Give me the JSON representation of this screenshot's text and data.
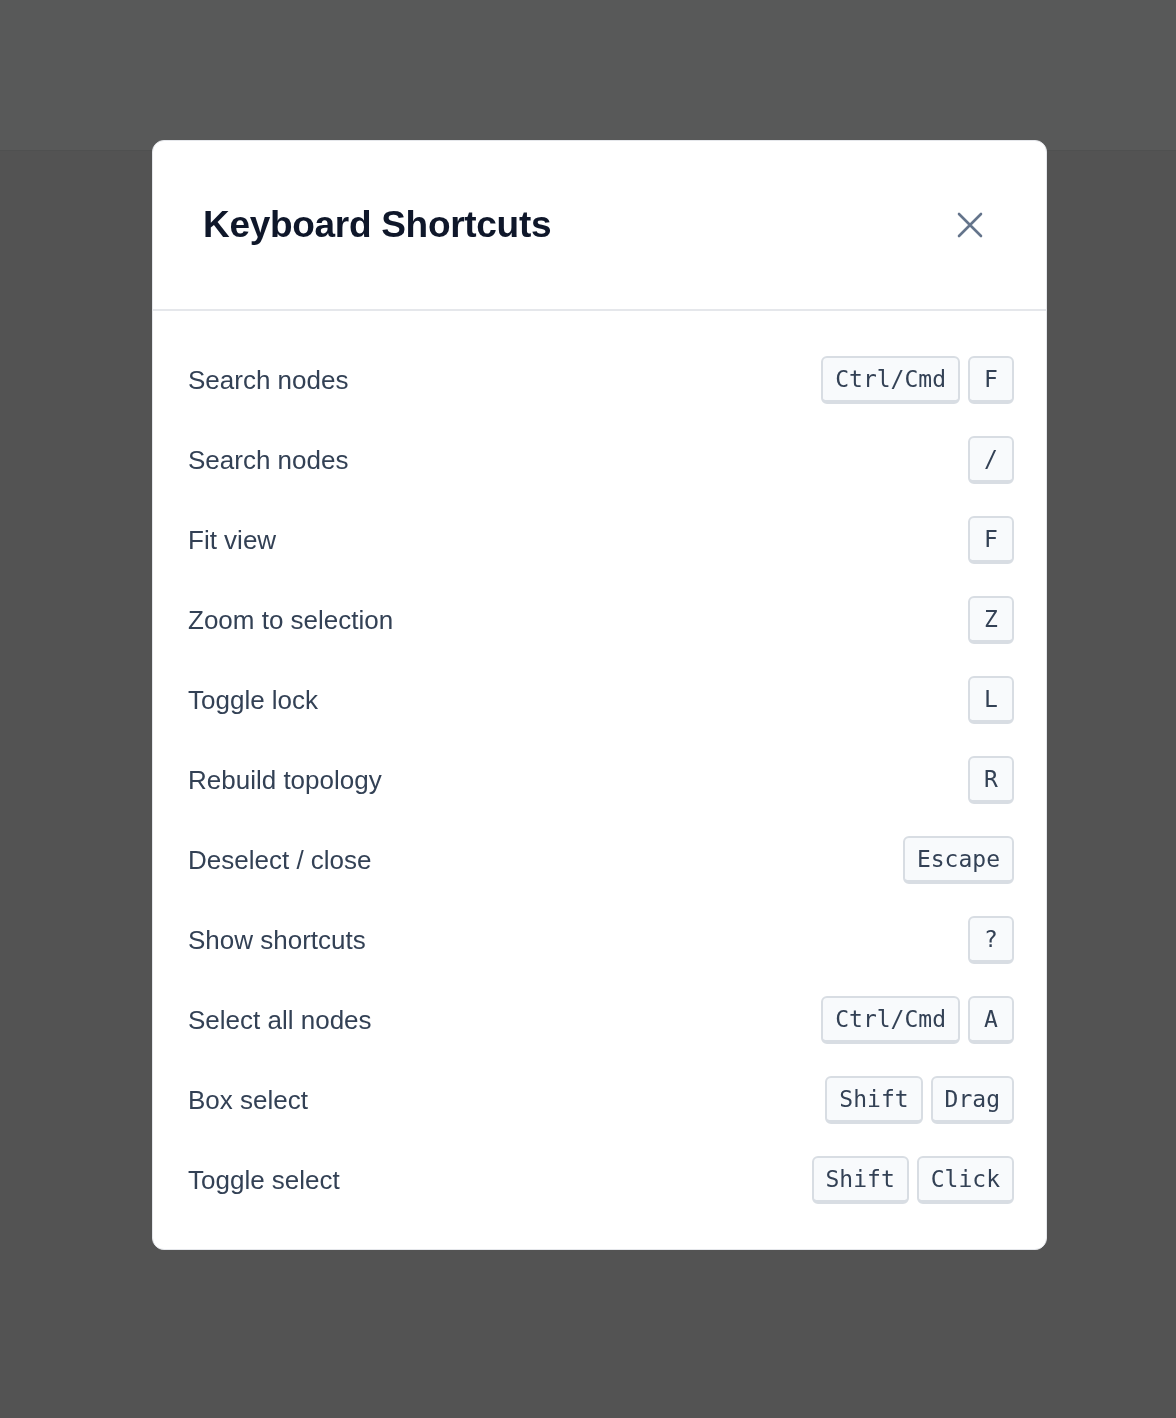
{
  "dialog": {
    "title": "Keyboard Shortcuts",
    "shortcuts": [
      {
        "label": "Search nodes",
        "keys": [
          "Ctrl/Cmd",
          "F"
        ]
      },
      {
        "label": "Search nodes",
        "keys": [
          "/"
        ]
      },
      {
        "label": "Fit view",
        "keys": [
          "F"
        ]
      },
      {
        "label": "Zoom to selection",
        "keys": [
          "Z"
        ]
      },
      {
        "label": "Toggle lock",
        "keys": [
          "L"
        ]
      },
      {
        "label": "Rebuild topology",
        "keys": [
          "R"
        ]
      },
      {
        "label": "Deselect / close",
        "keys": [
          "Escape"
        ]
      },
      {
        "label": "Show shortcuts",
        "keys": [
          "?"
        ]
      },
      {
        "label": "Select all nodes",
        "keys": [
          "Ctrl/Cmd",
          "A"
        ]
      },
      {
        "label": "Box select",
        "keys": [
          "Shift",
          "Drag"
        ]
      },
      {
        "label": "Toggle select",
        "keys": [
          "Shift",
          "Click"
        ]
      }
    ]
  }
}
